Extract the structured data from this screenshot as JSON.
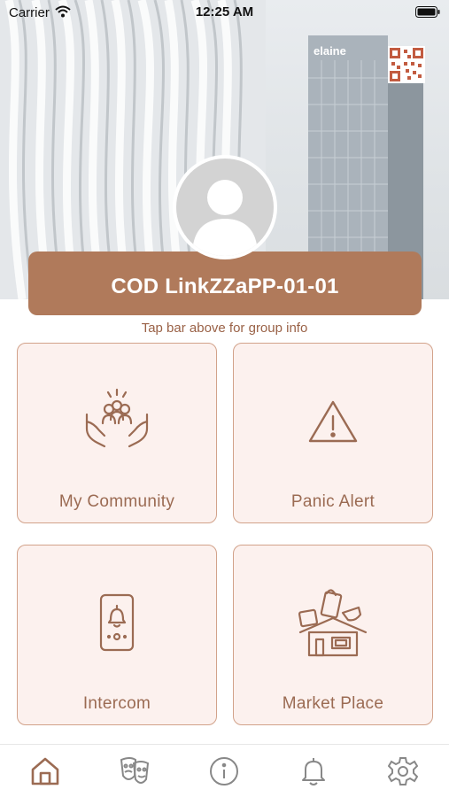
{
  "status_bar": {
    "carrier": "Carrier",
    "time": "12:25 AM"
  },
  "header": {
    "building_sign": "elaine"
  },
  "group": {
    "name": "COD LinkZZaPP-01-01",
    "hint": "Tap bar above for group info"
  },
  "tiles": [
    {
      "label": "My Community",
      "icon": "community-hands-icon"
    },
    {
      "label": "Panic Alert",
      "icon": "warning-triangle-icon"
    },
    {
      "label": "Intercom",
      "icon": "doorbell-intercom-icon"
    },
    {
      "label": "Market Place",
      "icon": "market-shop-icon"
    }
  ],
  "tabbar": {
    "items": [
      {
        "icon": "home-icon",
        "active": true
      },
      {
        "icon": "theater-masks-icon",
        "active": false
      },
      {
        "icon": "info-icon",
        "active": false
      },
      {
        "icon": "bell-icon",
        "active": false
      },
      {
        "icon": "gear-icon",
        "active": false
      }
    ]
  },
  "colors": {
    "accent": "#b07a5b",
    "tile_bg": "#fcf1ee",
    "tile_border": "#d2a28a",
    "tile_text": "#9b6b53",
    "hint_text": "#9a6247",
    "tab_active": "#9b6b53",
    "tab_inactive": "#888888"
  }
}
